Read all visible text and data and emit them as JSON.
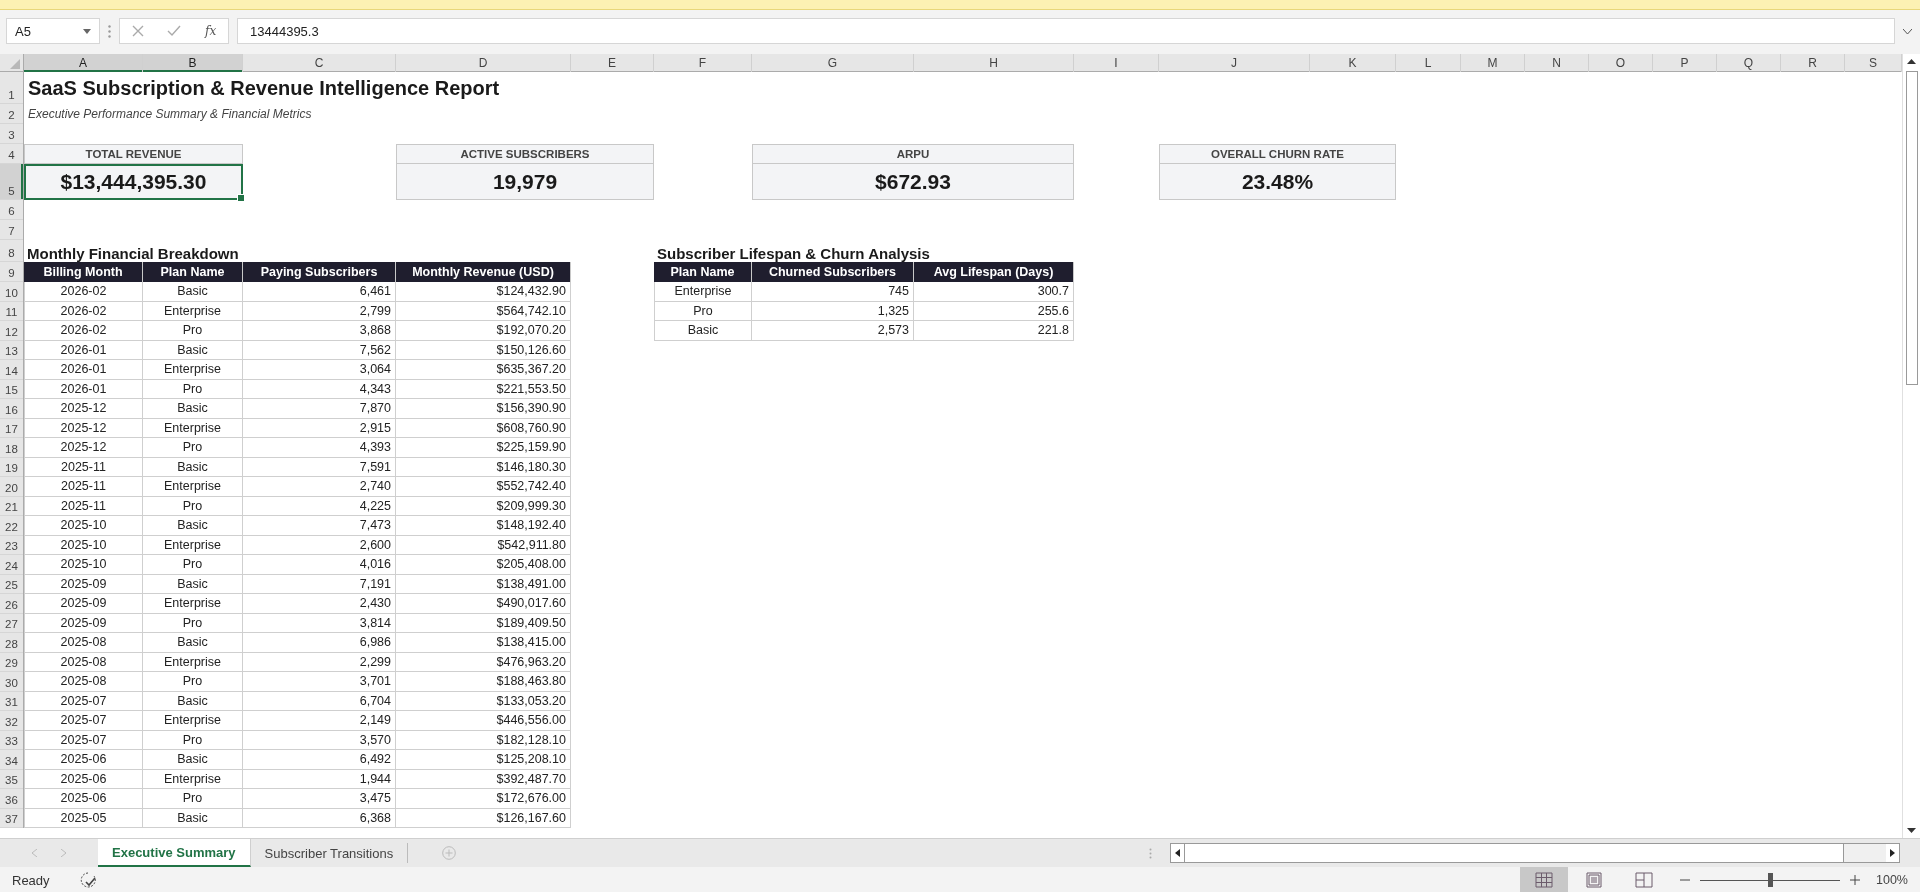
{
  "name_box": {
    "value": "A5"
  },
  "formula_bar": {
    "function_label": "fx",
    "value": "13444395.3"
  },
  "columns": [
    {
      "label": "A",
      "selected": true
    },
    {
      "label": "B",
      "selected": true
    },
    {
      "label": "C",
      "selected": false
    },
    {
      "label": "D",
      "selected": false
    },
    {
      "label": "E",
      "selected": false
    },
    {
      "label": "F",
      "selected": false
    },
    {
      "label": "G",
      "selected": false
    },
    {
      "label": "H",
      "selected": false
    },
    {
      "label": "I",
      "selected": false
    },
    {
      "label": "J",
      "selected": false
    },
    {
      "label": "K",
      "selected": false
    },
    {
      "label": "L",
      "selected": false
    },
    {
      "label": "M",
      "selected": false
    },
    {
      "label": "N",
      "selected": false
    },
    {
      "label": "O",
      "selected": false
    },
    {
      "label": "P",
      "selected": false
    },
    {
      "label": "Q",
      "selected": false
    },
    {
      "label": "R",
      "selected": false
    },
    {
      "label": "S",
      "selected": false
    }
  ],
  "rows": [
    {
      "label": "1",
      "selected": false
    },
    {
      "label": "2",
      "selected": false
    },
    {
      "label": "3",
      "selected": false
    },
    {
      "label": "4",
      "selected": false
    },
    {
      "label": "5",
      "selected": true
    },
    {
      "label": "6",
      "selected": false
    },
    {
      "label": "7",
      "selected": false
    },
    {
      "label": "8",
      "selected": false
    },
    {
      "label": "9",
      "selected": false
    },
    {
      "label": "10",
      "selected": false
    },
    {
      "label": "11",
      "selected": false
    },
    {
      "label": "12",
      "selected": false
    },
    {
      "label": "13",
      "selected": false
    },
    {
      "label": "14",
      "selected": false
    },
    {
      "label": "15",
      "selected": false
    },
    {
      "label": "16",
      "selected": false
    },
    {
      "label": "17",
      "selected": false
    },
    {
      "label": "18",
      "selected": false
    },
    {
      "label": "19",
      "selected": false
    },
    {
      "label": "20",
      "selected": false
    },
    {
      "label": "21",
      "selected": false
    },
    {
      "label": "22",
      "selected": false
    },
    {
      "label": "23",
      "selected": false
    },
    {
      "label": "24",
      "selected": false
    },
    {
      "label": "25",
      "selected": false
    },
    {
      "label": "26",
      "selected": false
    },
    {
      "label": "27",
      "selected": false
    },
    {
      "label": "28",
      "selected": false
    },
    {
      "label": "29",
      "selected": false
    },
    {
      "label": "30",
      "selected": false
    },
    {
      "label": "31",
      "selected": false
    },
    {
      "label": "32",
      "selected": false
    },
    {
      "label": "33",
      "selected": false
    },
    {
      "label": "34",
      "selected": false
    },
    {
      "label": "35",
      "selected": false
    },
    {
      "label": "36",
      "selected": false
    },
    {
      "label": "37",
      "selected": false
    }
  ],
  "report": {
    "title": "SaaS Subscription & Revenue Intelligence Report",
    "subtitle": "Executive Performance Summary & Financial Metrics"
  },
  "kpis": [
    {
      "label": "TOTAL REVENUE",
      "value": "$13,444,395.30",
      "selected": true
    },
    {
      "label": "ACTIVE SUBSCRIBERS",
      "value": "19,979",
      "selected": false
    },
    {
      "label": "ARPU",
      "value": "$672.93",
      "selected": false
    },
    {
      "label": "OVERALL CHURN RATE",
      "value": "23.48%",
      "selected": false
    }
  ],
  "monthly_table": {
    "title": "Monthly Financial Breakdown",
    "columns": [
      "Billing Month",
      "Plan Name",
      "Paying Subscribers",
      "Monthly Revenue (USD)"
    ],
    "rows": [
      [
        "2026-02",
        "Basic",
        "6,461",
        "$124,432.90"
      ],
      [
        "2026-02",
        "Enterprise",
        "2,799",
        "$564,742.10"
      ],
      [
        "2026-02",
        "Pro",
        "3,868",
        "$192,070.20"
      ],
      [
        "2026-01",
        "Basic",
        "7,562",
        "$150,126.60"
      ],
      [
        "2026-01",
        "Enterprise",
        "3,064",
        "$635,367.20"
      ],
      [
        "2026-01",
        "Pro",
        "4,343",
        "$221,553.50"
      ],
      [
        "2025-12",
        "Basic",
        "7,870",
        "$156,390.90"
      ],
      [
        "2025-12",
        "Enterprise",
        "2,915",
        "$608,760.90"
      ],
      [
        "2025-12",
        "Pro",
        "4,393",
        "$225,159.90"
      ],
      [
        "2025-11",
        "Basic",
        "7,591",
        "$146,180.30"
      ],
      [
        "2025-11",
        "Enterprise",
        "2,740",
        "$552,742.40"
      ],
      [
        "2025-11",
        "Pro",
        "4,225",
        "$209,999.30"
      ],
      [
        "2025-10",
        "Basic",
        "7,473",
        "$148,192.40"
      ],
      [
        "2025-10",
        "Enterprise",
        "2,600",
        "$542,911.80"
      ],
      [
        "2025-10",
        "Pro",
        "4,016",
        "$205,408.00"
      ],
      [
        "2025-09",
        "Basic",
        "7,191",
        "$138,491.00"
      ],
      [
        "2025-09",
        "Enterprise",
        "2,430",
        "$490,017.60"
      ],
      [
        "2025-09",
        "Pro",
        "3,814",
        "$189,409.50"
      ],
      [
        "2025-08",
        "Basic",
        "6,986",
        "$138,415.00"
      ],
      [
        "2025-08",
        "Enterprise",
        "2,299",
        "$476,963.20"
      ],
      [
        "2025-08",
        "Pro",
        "3,701",
        "$188,463.80"
      ],
      [
        "2025-07",
        "Basic",
        "6,704",
        "$133,053.20"
      ],
      [
        "2025-07",
        "Enterprise",
        "2,149",
        "$446,556.00"
      ],
      [
        "2025-07",
        "Pro",
        "3,570",
        "$182,128.10"
      ],
      [
        "2025-06",
        "Basic",
        "6,492",
        "$125,208.10"
      ],
      [
        "2025-06",
        "Enterprise",
        "1,944",
        "$392,487.70"
      ],
      [
        "2025-06",
        "Pro",
        "3,475",
        "$172,676.00"
      ],
      [
        "2025-05",
        "Basic",
        "6,368",
        "$126,167.60"
      ]
    ]
  },
  "churn_table": {
    "title": "Subscriber Lifespan & Churn Analysis",
    "columns": [
      "Plan Name",
      "Churned Subscribers",
      "Avg Lifespan (Days)"
    ],
    "rows": [
      [
        "Enterprise",
        "745",
        "300.7"
      ],
      [
        "Pro",
        "1,325",
        "255.6"
      ],
      [
        "Basic",
        "2,573",
        "221.8"
      ]
    ]
  },
  "sheet_tabs": [
    {
      "label": "Executive Summary",
      "selected": true
    },
    {
      "label": "Subscriber Transitions",
      "selected": false
    }
  ],
  "status_bar": {
    "status": "Ready",
    "views": [
      {
        "kind": "normal",
        "selected": true
      },
      {
        "kind": "page_layout",
        "selected": false
      },
      {
        "kind": "page_break",
        "selected": false
      }
    ],
    "zoom": {
      "level": 0.5,
      "reading": "100%"
    }
  }
}
